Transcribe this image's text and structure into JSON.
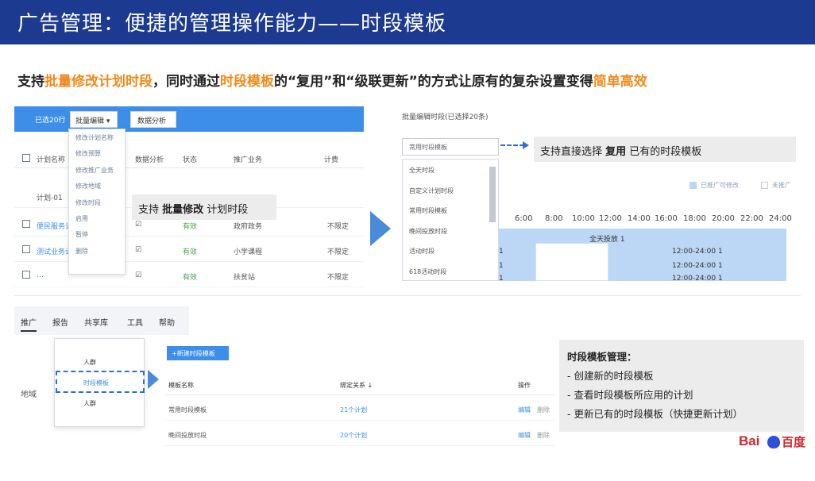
{
  "title": "广告管理：便捷的管理操作能力——时段模板",
  "subtitle": {
    "p1": "支持",
    "h1": "批量修改计划时段",
    "p2": "，同时通过",
    "h2": "时段模板",
    "p3": "的“复用”和“级联更新”的方式让原有的复杂设置变得",
    "h3": "简单高效"
  },
  "colors": {
    "title_bg": "#1c3a8f",
    "highlight": "#f08a1d",
    "accent": "#3d8ee8"
  },
  "batch": {
    "selected": "已选20行",
    "batch_edit_btn": "批量编辑 ▾",
    "data_btn": "数据分析",
    "menu": [
      "修改计划名称",
      "修改预算",
      "修改推广业务",
      "修改地域",
      "修改时段",
      "启用",
      "暂停",
      "删除"
    ],
    "headers": [
      "计划名称",
      "数据分析",
      "状态",
      "推广业务",
      "计费"
    ],
    "rows": [
      {
        "name": "计划-01",
        "status": "",
        "biz": "",
        "bill": ""
      },
      {
        "name": "便民服务计划",
        "status": "有效",
        "biz": "政府政务",
        "bill": "不限定"
      },
      {
        "name": "测试业务计划",
        "status": "有效",
        "biz": "小学课程",
        "bill": "不限定"
      },
      {
        "name": "…",
        "status": "有效",
        "biz": "扶贫站",
        "bill": "不限定"
      }
    ],
    "callout_pre": "支持 ",
    "callout_bold": "批量修改",
    "callout_post": " 计划时段"
  },
  "timeslot": {
    "header": "批量编辑时段(已选择20条)",
    "dropdown": "常用时段模板",
    "list": [
      "全天时段",
      "自定义计划时段",
      "常用时段模板",
      "晚间投放时段",
      "活动时段",
      "618活动时段"
    ],
    "callout_pre": "支持直接选择 ",
    "callout_bold": "复用",
    "callout_post": " 已有的时段模板",
    "legend_on": "已推广可修改",
    "legend_off": "未推广",
    "hours": [
      "6:00",
      "8:00",
      "10:00",
      "12:00",
      "14:00",
      "16:00",
      "18:00",
      "20:00",
      "22:00",
      "24:00"
    ],
    "bar_label": "全天投放 1",
    "row_labels": [
      "12:00-24:00 1",
      "12:00-24:00 1",
      "12:00-24:00 1"
    ],
    "left_marks": [
      "1",
      "1",
      "1"
    ]
  },
  "template": {
    "tabs": [
      "推广",
      "报告",
      "共享库",
      "工具",
      "帮助"
    ],
    "menu": [
      "人群",
      "时段模板",
      "人群"
    ],
    "label": "地域",
    "new_btn": "+新建时段模板",
    "headers": [
      "模板名称",
      "绑定关系 ↓",
      "操作"
    ],
    "rows": [
      {
        "name": "常用时段模板",
        "bind": "21个计划",
        "edit": "编辑",
        "del": "删除"
      },
      {
        "name": "晚间投放时段",
        "bind": "20个计划",
        "edit": "编辑",
        "del": "删除"
      }
    ]
  },
  "info": {
    "title": "时段模板管理：",
    "items": [
      "- 创建新的时段模板",
      "- 查看时段模板所应用的计划",
      "- 更新已有的时段模板（快捷更新计划）"
    ]
  },
  "logo": {
    "bai": "Bai",
    "du": "百度"
  }
}
